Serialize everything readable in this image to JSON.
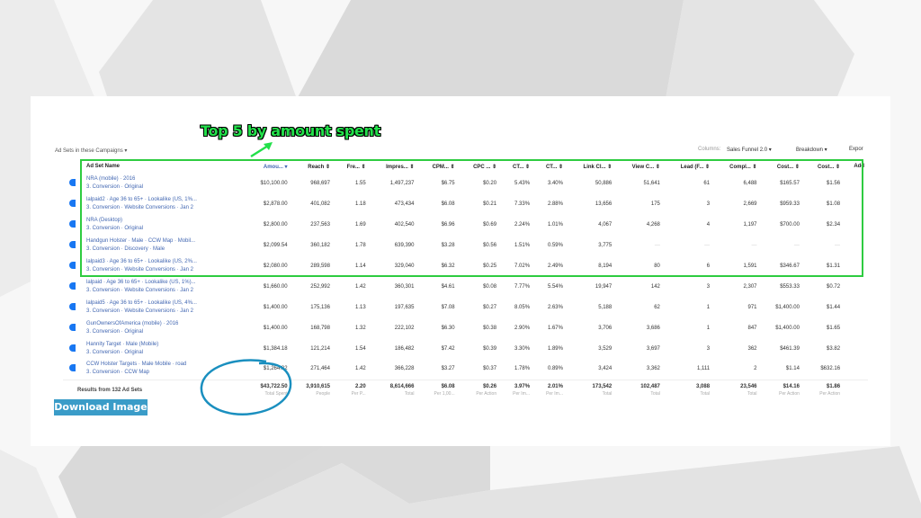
{
  "annotation": {
    "title": "Top 5 by amount spent",
    "highlight_color": "#2ecc40",
    "circle_color": "#1a8fbf",
    "circled_value": "$43,722.50"
  },
  "header": {
    "section_label": "Ad Sets in these Campaigns ▾",
    "columns_label": "Columns:",
    "columns_value": "Sales Funnel 2.0 ▾",
    "breakdown_label": "Breakdown ▾",
    "export_label": "Expor"
  },
  "table": {
    "columns": [
      "Ad Set Name",
      "Amou... ▾",
      "Reach ⇕",
      "Fre... ⇕",
      "Impres... ⇕",
      "CPM... ⇕",
      "CPC ... ⇕",
      "CT... ⇕",
      "CT... ⇕",
      "Link Cl... ⇕",
      "View C... ⇕",
      "Lead (F... ⇕",
      "Compl... ⇕",
      "Cost... ⇕",
      "Cost... ⇕",
      "Add"
    ],
    "rows": [
      {
        "name": "NRA (mobile) · 2016",
        "sub": "3. Conversion · Original",
        "cells": [
          "$10,100.00",
          "968,697",
          "1.55",
          "1,497,237",
          "$6.75",
          "$0.20",
          "5.43%",
          "3.40%",
          "50,886",
          "51,641",
          "61",
          "6,488",
          "$165.57",
          "$1.56",
          ""
        ]
      },
      {
        "name": "lalpaid2 · Age 36 to 65+ · Lookalike (US, 1%...",
        "sub": "3. Conversion · Website Conversions · Jan 2",
        "cells": [
          "$2,878.00",
          "401,082",
          "1.18",
          "473,434",
          "$6.08",
          "$0.21",
          "7.33%",
          "2.88%",
          "13,656",
          "175",
          "3",
          "2,669",
          "$959.33",
          "$1.08",
          ""
        ]
      },
      {
        "name": "NRA (Desktop)",
        "sub": "3. Conversion · Original",
        "cells": [
          "$2,800.00",
          "237,563",
          "1.69",
          "402,540",
          "$6.96",
          "$0.69",
          "2.24%",
          "1.01%",
          "4,067",
          "4,268",
          "4",
          "1,197",
          "$700.00",
          "$2.34",
          ""
        ]
      },
      {
        "name": "Handgun Holster · Male · CCW Map · Mobil...",
        "sub": "3. Conversion · Discovery · Male",
        "cells": [
          "$2,099.54",
          "360,182",
          "1.78",
          "639,390",
          "$3.28",
          "$0.56",
          "1.51%",
          "0.59%",
          "3,775",
          "—",
          "—",
          "—",
          "—",
          "—",
          ""
        ]
      },
      {
        "name": "lalpaid3 · Age 36 to 65+ · Lookalike (US, 2%...",
        "sub": "3. Conversion · Website Conversions · Jan 2",
        "cells": [
          "$2,080.00",
          "289,598",
          "1.14",
          "329,040",
          "$6.32",
          "$0.25",
          "7.02%",
          "2.49%",
          "8,194",
          "80",
          "6",
          "1,591",
          "$346.67",
          "$1.31",
          ""
        ]
      },
      {
        "name": "lalpaid · Age 36 to 65+ · Lookalike (US, 1%)...",
        "sub": "3. Conversion · Website Conversions · Jan 2",
        "cells": [
          "$1,660.00",
          "252,992",
          "1.42",
          "360,301",
          "$4.61",
          "$0.08",
          "7.77%",
          "5.54%",
          "19,947",
          "142",
          "3",
          "2,307",
          "$553.33",
          "$0.72",
          ""
        ]
      },
      {
        "name": "lalpaid5 · Age 36 to 65+ · Lookalike (US, 4%...",
        "sub": "3. Conversion · Website Conversions · Jan 2",
        "cells": [
          "$1,400.00",
          "175,136",
          "1.13",
          "197,635",
          "$7.08",
          "$0.27",
          "8.05%",
          "2.63%",
          "5,188",
          "62",
          "1",
          "971",
          "$1,400.00",
          "$1.44",
          ""
        ]
      },
      {
        "name": "GunOwnersOfAmerica (mobile) · 2016",
        "sub": "3. Conversion · Original",
        "cells": [
          "$1,400.00",
          "168,798",
          "1.32",
          "222,102",
          "$6.30",
          "$0.38",
          "2.90%",
          "1.67%",
          "3,706",
          "3,686",
          "1",
          "847",
          "$1,400.00",
          "$1.65",
          ""
        ]
      },
      {
        "name": "Hannity Target · Male (Mobile)",
        "sub": "3. Conversion · Original",
        "cells": [
          "$1,384.18",
          "121,214",
          "1.54",
          "186,482",
          "$7.42",
          "$0.39",
          "3.30%",
          "1.89%",
          "3,529",
          "3,697",
          "3",
          "362",
          "$461.39",
          "$3.82",
          ""
        ]
      },
      {
        "name": "CCW Holster Targets · Male Mobile · road",
        "sub": "3. Conversion · CCW Map",
        "cells": [
          "$1,264.32",
          "271,464",
          "1.42",
          "366,228",
          "$3.27",
          "$0.37",
          "1.78%",
          "0.89%",
          "3,424",
          "3,362",
          "1,111",
          "2",
          "$1.14",
          "$632.16",
          ""
        ]
      }
    ],
    "summary": {
      "label": "Results from 132 Ad Sets",
      "cells": [
        {
          "value": "$43,722.50",
          "label": "Total Spent"
        },
        {
          "value": "3,910,615",
          "label": "People"
        },
        {
          "value": "2.20",
          "label": "Per P..."
        },
        {
          "value": "8,614,666",
          "label": "Total"
        },
        {
          "value": "$6.08",
          "label": "Per 1,00..."
        },
        {
          "value": "$0.26",
          "label": "Per Action"
        },
        {
          "value": "3.97%",
          "label": "Per Im..."
        },
        {
          "value": "2.01%",
          "label": "Per Im..."
        },
        {
          "value": "173,542",
          "label": "Total"
        },
        {
          "value": "102,487",
          "label": "Total"
        },
        {
          "value": "3,088",
          "label": "Total"
        },
        {
          "value": "23,546",
          "label": "Total"
        },
        {
          "value": "$14.16",
          "label": "Per Action"
        },
        {
          "value": "$1.86",
          "label": "Per Action"
        },
        {
          "value": "",
          "label": ""
        }
      ]
    }
  },
  "download_button": {
    "label": "Download Image",
    "color": "#3a9cc8"
  }
}
